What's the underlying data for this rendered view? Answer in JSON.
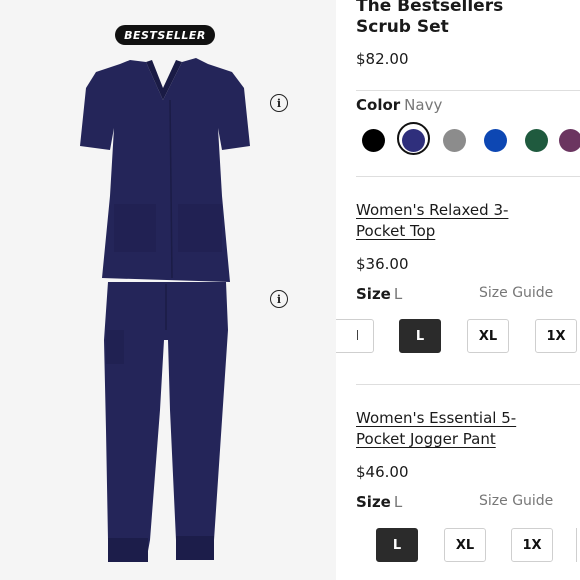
{
  "image_panel": {
    "badge": "BESTSELLER",
    "top_info": "i",
    "pants_info": "i"
  },
  "product": {
    "title_line1": "The Bestsellers",
    "title_line2": "Scrub Set",
    "price": "$82.00"
  },
  "color": {
    "label": "Color",
    "selected": "Navy",
    "swatches": [
      {
        "name": "Black",
        "hex": "#000000"
      },
      {
        "name": "Navy",
        "hex": "#2f2f7c"
      },
      {
        "name": "Grey",
        "hex": "#8c8c8c"
      },
      {
        "name": "Royal Blue",
        "hex": "#0d47b3"
      },
      {
        "name": "Green",
        "hex": "#1f5a3e"
      },
      {
        "name": "Purple",
        "hex": "#6b3560"
      }
    ]
  },
  "item1": {
    "name_line1": "Women's Relaxed 3-",
    "name_line2": "Pocket Top",
    "price": "$36.00",
    "size_label": "Size",
    "size_selected": "L",
    "size_guide": "Size Guide",
    "sizes": [
      "M",
      "L",
      "XL",
      "1X"
    ]
  },
  "item2": {
    "name_line1": "Women's Essential 5-",
    "name_line2": "Pocket Jogger Pant",
    "price": "$46.00",
    "size_label": "Size",
    "size_selected": "L",
    "size_guide": "Size Guide",
    "sizes": [
      "L",
      "XL",
      "1X"
    ]
  }
}
